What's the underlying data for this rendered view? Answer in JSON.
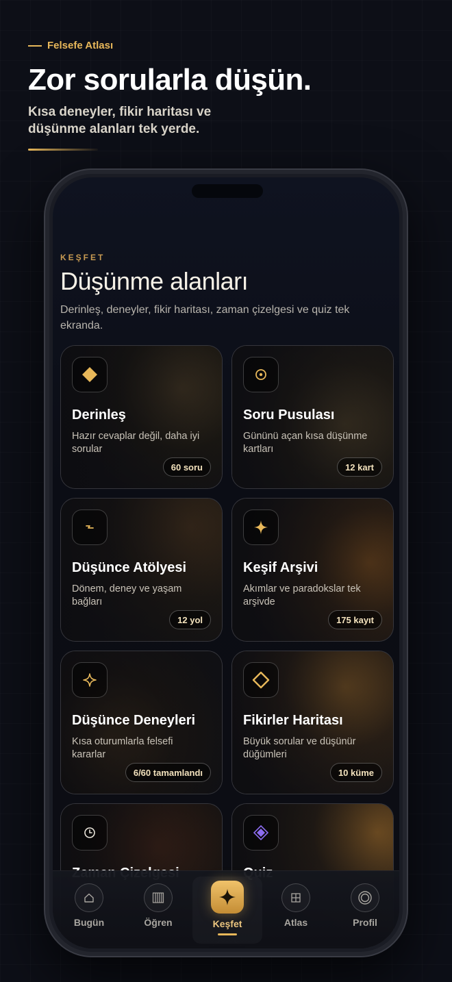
{
  "hero": {
    "eyebrow": "Felsefe Atlası",
    "headline": "Zor sorularla düşün.",
    "subtitle": "Kısa deneyler, fikir haritası ve düşünme alanları tek yerde."
  },
  "screen": {
    "kicker": "KEŞFET",
    "title": "Düşünme alanları",
    "description": "Derinleş, deneyler, fikir haritası, zaman çizelgesi ve quiz tek ekranda."
  },
  "cards": [
    {
      "title": "Derinleş",
      "desc": "Hazır cevaplar değil, daha iyi sorular",
      "badge": "60 soru",
      "icon": "diamond-filled-icon"
    },
    {
      "title": "Soru Pusulası",
      "desc": "Gününü açan kısa düşünme kartları",
      "badge": "12 kart",
      "icon": "compass-icon"
    },
    {
      "title": "Düşünce Atölyesi",
      "desc": "Dönem, deney ve yaşam bağları",
      "badge": "12 yol",
      "icon": "bolt-icon"
    },
    {
      "title": "Keşif Arşivi",
      "desc": "Akımlar ve paradokslar tek arşivde",
      "badge": "175 kayıt",
      "icon": "sparkle-filled-icon"
    },
    {
      "title": "Düşünce Deneyleri",
      "desc": "Kısa oturumlarla felsefi kararlar",
      "badge": "6/60 tamamlandı",
      "icon": "sparkle-outline-icon"
    },
    {
      "title": "Fikirler Haritası",
      "desc": "Büyük sorular ve düşünür düğümleri",
      "badge": "10 küme",
      "icon": "diamond-outline-icon"
    },
    {
      "title": "Zaman Çizelgesi",
      "desc": "",
      "badge": "",
      "icon": "clock-icon"
    },
    {
      "title": "Quiz",
      "desc": "",
      "badge": "",
      "icon": "gem-icon"
    }
  ],
  "tabs": [
    {
      "label": "Bugün",
      "icon": "home-icon"
    },
    {
      "label": "Öğren",
      "icon": "library-icon"
    },
    {
      "label": "Keşfet",
      "icon": "sparkle-icon",
      "active": true
    },
    {
      "label": "Atlas",
      "icon": "grid-icon"
    },
    {
      "label": "Profil",
      "icon": "profile-icon"
    }
  ],
  "colors": {
    "accent": "#e8b85a",
    "background": "#0d0f17",
    "quiz_icon": "#8c6cf0"
  }
}
